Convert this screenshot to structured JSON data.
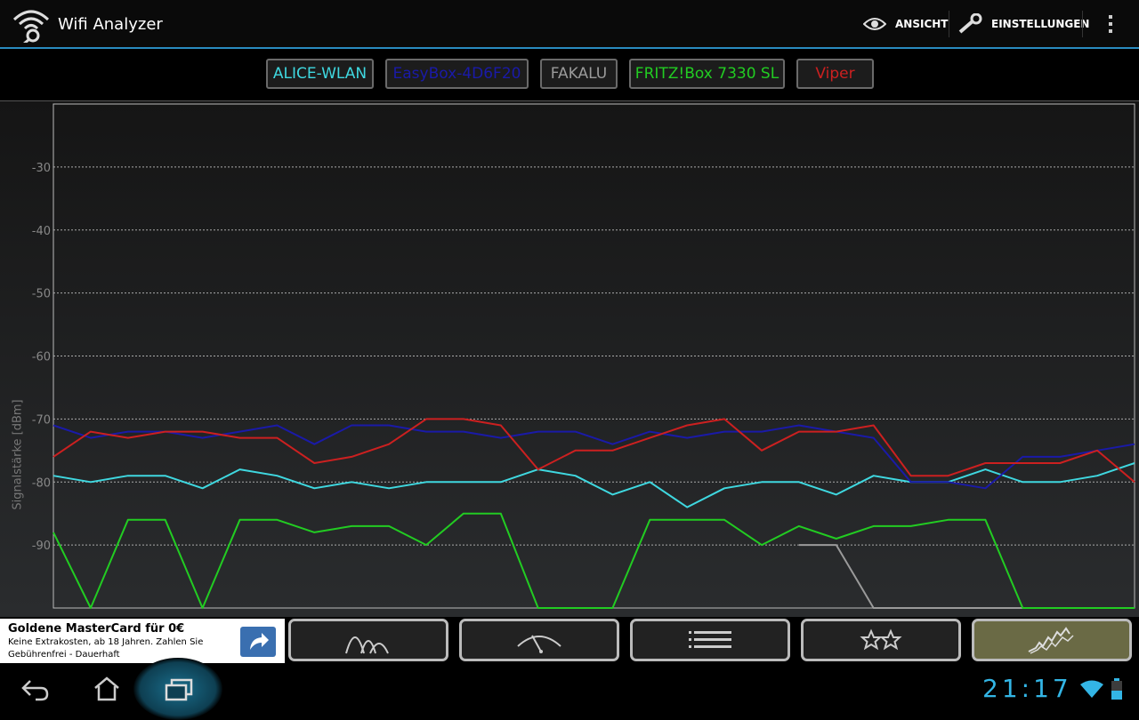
{
  "app": {
    "title": "Wifi Analyzer"
  },
  "actions": {
    "view_label": "ANSICHT",
    "settings_label": "EINSTELLUNGEN"
  },
  "networks": [
    {
      "name": "ALICE-WLAN",
      "color": "#3fd8e0"
    },
    {
      "name": "EasyBox-4D6F20",
      "color": "#1a1aa8"
    },
    {
      "name": "FAKALU",
      "color": "#9a9a9a"
    },
    {
      "name": "FRITZ!Box 7330 SL",
      "color": "#22cc22"
    },
    {
      "name": "Viper",
      "color": "#cc2020"
    }
  ],
  "chart_data": {
    "type": "line",
    "ylabel": "Signalstärke [dBm]",
    "yticks": [
      -30,
      -40,
      -50,
      -60,
      -70,
      -80,
      -90
    ],
    "ylim": [
      -100,
      -20
    ],
    "grid": true,
    "x": [
      0,
      1,
      2,
      3,
      4,
      5,
      6,
      7,
      8,
      9,
      10,
      11,
      12,
      13,
      14,
      15,
      16,
      17,
      18,
      19,
      20,
      21,
      22,
      23,
      24,
      25,
      26,
      27,
      28,
      29
    ],
    "series": [
      {
        "name": "ALICE-WLAN",
        "color": "#3fd8e0",
        "values": [
          -79,
          -80,
          -79,
          -79,
          -81,
          -78,
          -79,
          -81,
          -80,
          -81,
          -80,
          -80,
          -80,
          -78,
          -79,
          -82,
          -80,
          -84,
          -81,
          -80,
          -80,
          -82,
          -79,
          -80,
          -80,
          -78,
          -80,
          -80,
          -79,
          -77
        ]
      },
      {
        "name": "EasyBox-4D6F20",
        "color": "#1a1aa8",
        "values": [
          -71,
          -73,
          -72,
          -72,
          -73,
          -72,
          -71,
          -74,
          -71,
          -71,
          -72,
          -72,
          -73,
          -72,
          -72,
          -74,
          -72,
          -73,
          -72,
          -72,
          -71,
          -72,
          -73,
          -80,
          -80,
          -81,
          -76,
          -76,
          -75,
          -74
        ]
      },
      {
        "name": "FAKALU",
        "color": "#9a9a9a",
        "values": [
          null,
          null,
          null,
          null,
          null,
          null,
          null,
          null,
          null,
          null,
          null,
          null,
          null,
          null,
          null,
          null,
          null,
          null,
          null,
          null,
          -90,
          -90,
          -100,
          -100,
          -100,
          -100,
          -100,
          -100,
          -100,
          -100
        ]
      },
      {
        "name": "FRITZ!Box 7330 SL",
        "color": "#22cc22",
        "values": [
          -88,
          -100,
          -86,
          -86,
          -100,
          -86,
          -86,
          -88,
          -87,
          -87,
          -90,
          -85,
          -85,
          -100,
          -100,
          -100,
          -86,
          -86,
          -86,
          -90,
          -87,
          -89,
          -87,
          -87,
          -86,
          -86,
          -100,
          -100,
          -100,
          -100
        ]
      },
      {
        "name": "Viper",
        "color": "#cc2020",
        "values": [
          -76,
          -72,
          -73,
          -72,
          -72,
          -73,
          -73,
          -77,
          -76,
          -74,
          -70,
          -70,
          -71,
          -78,
          -75,
          -75,
          -73,
          -71,
          -70,
          -75,
          -72,
          -72,
          -71,
          -79,
          -79,
          -77,
          -77,
          -77,
          -75,
          -80
        ]
      }
    ]
  },
  "ad": {
    "title": "Goldene MasterCard für 0€",
    "text": "Keine Extrakosten, ab 18 Jahren. Zahlen Sie Gebührenfrei - Dauerhaft"
  },
  "status": {
    "time": "21:17"
  }
}
